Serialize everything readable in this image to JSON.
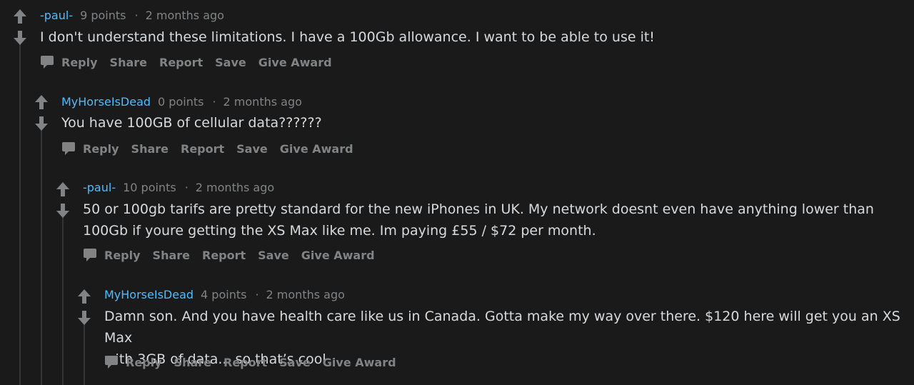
{
  "comments": [
    {
      "author": "-paul-",
      "points": "9 points",
      "separator": "·",
      "time": "2 months ago",
      "body": "I don't understand these limitations. I have a 100Gb allowance. I want to be able to use it!",
      "actions": [
        "Reply",
        "Share",
        "Report",
        "Save",
        "Give Award"
      ]
    },
    {
      "author": "MyHorseIsDead",
      "points": "0 points",
      "separator": "·",
      "time": "2 months ago",
      "body": "You have 100GB of cellular data??????",
      "actions": [
        "Reply",
        "Share",
        "Report",
        "Save",
        "Give Award"
      ]
    },
    {
      "author": "-paul-",
      "points": "10 points",
      "separator": "·",
      "time": "2 months ago",
      "body_lines": [
        "50 or 100gb tarifs are pretty standard for the new iPhones in UK. My network doesnt even have anything lower than",
        "100Gb if youre getting the XS Max like me. Im paying £55 / $72 per month."
      ],
      "actions": [
        "Reply",
        "Share",
        "Report",
        "Save",
        "Give Award"
      ]
    },
    {
      "author": "MyHorseIsDead",
      "points": "4 points",
      "separator": "·",
      "time": "2 months ago",
      "body_lines": [
        "Damn son. And you have health care like us in Canada. Gotta make my way over there. $120 here will get you an XS Max",
        "with 3GB of data... so that’s cool"
      ],
      "actions": [
        "Reply",
        "Share",
        "Report",
        "Save",
        "Give Award"
      ]
    }
  ],
  "icons": {
    "upvote": "arrow-up-icon",
    "downvote": "arrow-down-icon",
    "reply": "speech-bubble-icon"
  },
  "colors": {
    "background": "#1a1a1b",
    "author": "#4fbcff",
    "meta": "#818384",
    "text": "#d7dadc",
    "thread_line": "#343536"
  }
}
